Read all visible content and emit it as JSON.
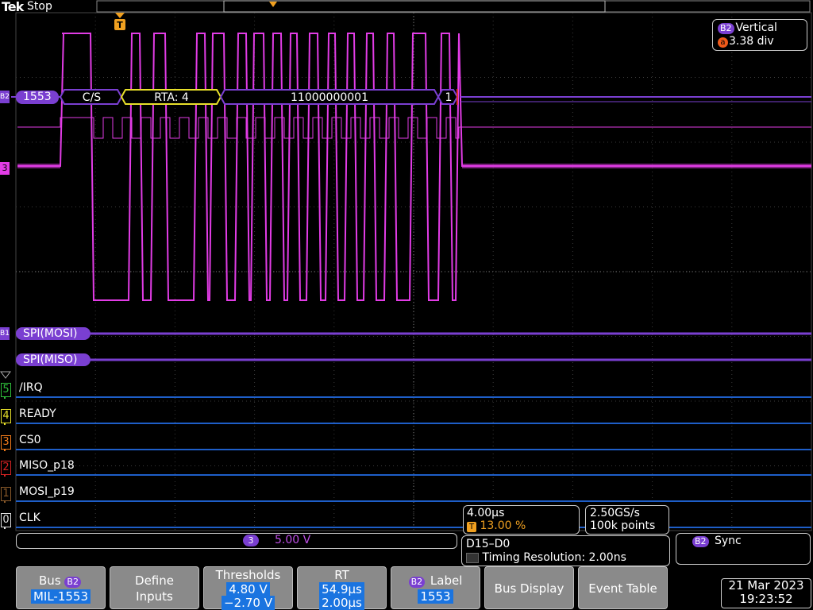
{
  "header": {
    "brand": "Tek",
    "state": "Stop"
  },
  "vertical_box": {
    "badge": "B2",
    "title": "Vertical",
    "icon": "a",
    "value": "3.38 div"
  },
  "bus_decode": {
    "bus_label": "1553",
    "bus_marker": "B2",
    "segments": [
      "C/S",
      "RTA: 4",
      "11000000001",
      "1"
    ]
  },
  "channel_markers": {
    "analog": "3",
    "spi_mosi_marker": "B1",
    "spi_mosi": "SPI(MOSI)",
    "spi_miso": "SPI(MISO)"
  },
  "digital_channels": [
    {
      "num": "5",
      "name": "/IRQ",
      "color": "#2fbf3a"
    },
    {
      "num": "4",
      "name": "READY",
      "color": "#e8e02a"
    },
    {
      "num": "3",
      "name": "CS0",
      "color": "#f07a1a"
    },
    {
      "num": "2",
      "name": "MISO_p18",
      "color": "#d42222"
    },
    {
      "num": "1",
      "name": "MOSI_p19",
      "color": "#8a5a2a"
    },
    {
      "num": "0",
      "name": "CLK",
      "color": "#dddddd"
    }
  ],
  "timebase": {
    "scale": "4.00µs",
    "trigger_pos": "13.00 %",
    "trigger_icon": "T"
  },
  "acquisition": {
    "rate": "2.50GS/s",
    "points": "100k points"
  },
  "channel_scale": {
    "channel": "3",
    "value": "5.00 V"
  },
  "digital_info": {
    "range": "D15–D0",
    "timing": "Timing Resolution: 2.00ns"
  },
  "sync_box": {
    "badge": "B2",
    "label": "Sync"
  },
  "softkeys": {
    "bus": {
      "label": "Bus",
      "badge": "B2",
      "value": "MIL-1553"
    },
    "define": {
      "line1": "Define",
      "line2": "Inputs"
    },
    "thresholds": {
      "label": "Thresholds",
      "v1": "4.80 V",
      "v2": "−2.70 V"
    },
    "rt": {
      "label": "RT",
      "v1": "54.9µs",
      "v2": "2.00µs"
    },
    "label_key": {
      "badge": "B2",
      "label": "Label",
      "value": "1553"
    },
    "bus_display": "Bus Display",
    "event_table": "Event Table"
  },
  "datetime": {
    "date": "21 Mar 2023",
    "time": "19:23:52"
  },
  "colors": {
    "waveform": "#e23ce6",
    "bus": "#7a3fd1",
    "digital_line": "#1e5ec8",
    "grid": "#555555"
  }
}
